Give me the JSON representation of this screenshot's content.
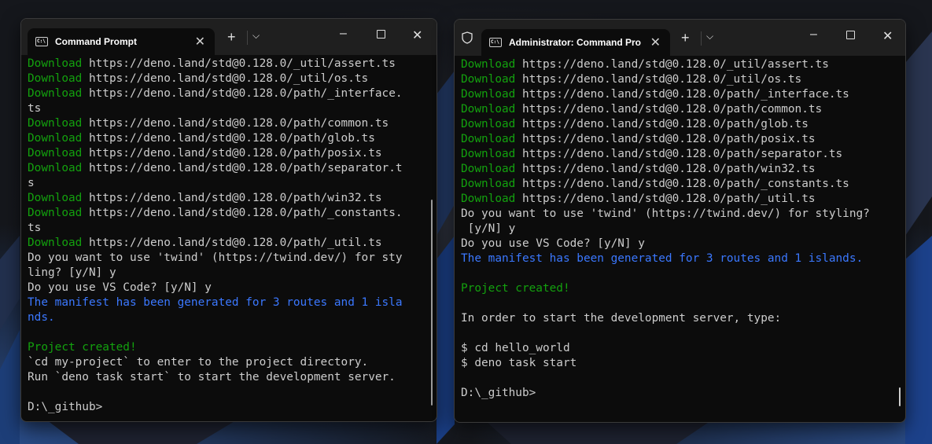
{
  "left_window": {
    "tab_title": "Command Prompt",
    "lines": [
      {
        "pre": "Download",
        "text": " https://deno.land/std@0.128.0/_util/assert.ts"
      },
      {
        "pre": "Download",
        "text": " https://deno.land/std@0.128.0/_util/os.ts"
      },
      {
        "pre": "Download",
        "text": " https://deno.land/std@0.128.0/path/_interface."
      },
      {
        "pre": "",
        "text": "ts"
      },
      {
        "pre": "Download",
        "text": " https://deno.land/std@0.128.0/path/common.ts"
      },
      {
        "pre": "Download",
        "text": " https://deno.land/std@0.128.0/path/glob.ts"
      },
      {
        "pre": "Download",
        "text": " https://deno.land/std@0.128.0/path/posix.ts"
      },
      {
        "pre": "Download",
        "text": " https://deno.land/std@0.128.0/path/separator.t"
      },
      {
        "pre": "",
        "text": "s"
      },
      {
        "pre": "Download",
        "text": " https://deno.land/std@0.128.0/path/win32.ts"
      },
      {
        "pre": "Download",
        "text": " https://deno.land/std@0.128.0/path/_constants."
      },
      {
        "pre": "",
        "text": "ts"
      },
      {
        "pre": "Download",
        "text": " https://deno.land/std@0.128.0/path/_util.ts"
      },
      {
        "pre": "",
        "text": "Do you want to use 'twind' (https://twind.dev/) for sty"
      },
      {
        "pre": "",
        "text": "ling? [y/N] y"
      },
      {
        "pre": "",
        "text": "Do you use VS Code? [y/N] y"
      },
      {
        "pre": "",
        "text": "",
        "blue": "The manifest has been generated for 3 routes and 1 isla"
      },
      {
        "pre": "",
        "text": "",
        "blue": "nds."
      },
      {
        "pre": "",
        "text": ""
      },
      {
        "pre": "Project created!",
        "text": ""
      },
      {
        "pre": "",
        "text": "`cd my-project` to enter to the project directory."
      },
      {
        "pre": "",
        "text": "Run `deno task start` to start the development server."
      },
      {
        "pre": "",
        "text": ""
      },
      {
        "pre": "",
        "text": "D:\\_github>"
      }
    ]
  },
  "right_window": {
    "tab_title": "Administrator: Command Pro",
    "lines": [
      {
        "pre": "Download",
        "text": " https://deno.land/std@0.128.0/_util/assert.ts"
      },
      {
        "pre": "Download",
        "text": " https://deno.land/std@0.128.0/_util/os.ts"
      },
      {
        "pre": "Download",
        "text": " https://deno.land/std@0.128.0/path/_interface.ts"
      },
      {
        "pre": "Download",
        "text": " https://deno.land/std@0.128.0/path/common.ts"
      },
      {
        "pre": "Download",
        "text": " https://deno.land/std@0.128.0/path/glob.ts"
      },
      {
        "pre": "Download",
        "text": " https://deno.land/std@0.128.0/path/posix.ts"
      },
      {
        "pre": "Download",
        "text": " https://deno.land/std@0.128.0/path/separator.ts"
      },
      {
        "pre": "Download",
        "text": " https://deno.land/std@0.128.0/path/win32.ts"
      },
      {
        "pre": "Download",
        "text": " https://deno.land/std@0.128.0/path/_constants.ts"
      },
      {
        "pre": "Download",
        "text": " https://deno.land/std@0.128.0/path/_util.ts"
      },
      {
        "pre": "",
        "text": "Do you want to use 'twind' (https://twind.dev/) for styling?"
      },
      {
        "pre": "",
        "text": " [y/N] y"
      },
      {
        "pre": "",
        "text": "Do you use VS Code? [y/N] y"
      },
      {
        "pre": "",
        "text": "",
        "blue": "The manifest has been generated for 3 routes and 1 islands."
      },
      {
        "pre": "",
        "text": ""
      },
      {
        "pre": "Project created!",
        "text": ""
      },
      {
        "pre": "",
        "text": ""
      },
      {
        "pre": "",
        "text": "In order to start the development server, type:"
      },
      {
        "pre": "",
        "text": ""
      },
      {
        "pre": "",
        "text": "$ cd hello_world"
      },
      {
        "pre": "",
        "text": "$ deno task start"
      },
      {
        "pre": "",
        "text": ""
      },
      {
        "pre": "",
        "text": "D:\\_github>"
      }
    ]
  },
  "icons": {
    "new_tab": "plus-icon",
    "dropdown": "chevron-down-icon",
    "minimize": "minimize-icon",
    "maximize": "maximize-icon",
    "close": "close-icon",
    "shield": "shield-icon"
  },
  "colors": {
    "green": "#13a10e",
    "blue": "#3b78ff",
    "text": "#cccccc",
    "terminal_bg": "#0c0c0c"
  }
}
